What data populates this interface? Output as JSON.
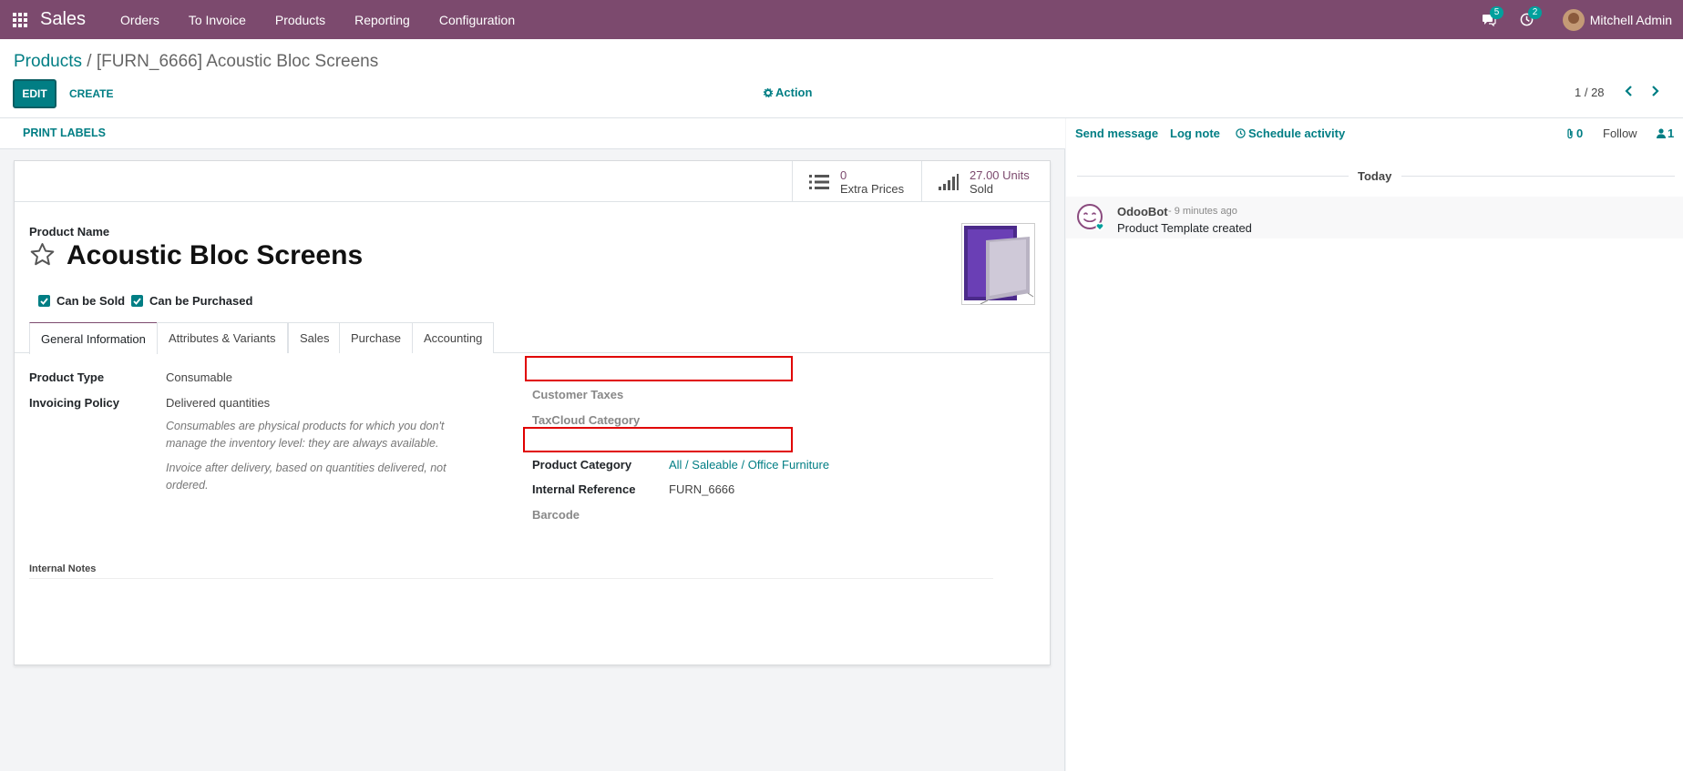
{
  "navbar": {
    "brand": "Sales",
    "menu": [
      "Orders",
      "To Invoice",
      "Products",
      "Reporting",
      "Configuration"
    ],
    "messages_badge": "5",
    "activities_badge": "2",
    "user_name": "Mitchell Admin",
    "color": "#7c4a6e"
  },
  "breadcrumb": {
    "parent": "Products",
    "separator": "/",
    "current": "[FURN_6666] Acoustic Bloc Screens"
  },
  "toolbar": {
    "edit_label": "EDIT",
    "create_label": "CREATE",
    "action_label": "Action",
    "pager": "1 / 28"
  },
  "statusbar": {
    "print_labels": "PRINT LABELS"
  },
  "smart_buttons": {
    "extra_prices_value": "0",
    "extra_prices_label": "Extra Prices",
    "sold_value": "27.00 Units",
    "sold_label": "Sold"
  },
  "product": {
    "name_label": "Product Name",
    "name": "Acoustic Bloc Screens",
    "can_be_sold": "Can be Sold",
    "can_be_purchased": "Can be Purchased"
  },
  "tabs": [
    "General Information",
    "Attributes & Variants",
    "Sales",
    "Purchase",
    "Accounting"
  ],
  "general": {
    "product_type_label": "Product Type",
    "product_type": "Consumable",
    "invoicing_policy_label": "Invoicing Policy",
    "invoicing_policy": "Delivered quantities",
    "help_consumable_1": "Consumables are physical products for which you don't",
    "help_consumable_2": "manage the inventory level: they are always available.",
    "help_invoice_1": "Invoice after delivery, based on quantities delivered, not",
    "help_invoice_2": "ordered.",
    "customer_taxes_label": "Customer Taxes",
    "taxcloud_label": "TaxCloud Category",
    "product_category_label": "Product Category",
    "product_category": "All / Saleable / Office Furniture",
    "internal_ref_label": "Internal Reference",
    "internal_ref": "FURN_6666",
    "barcode_label": "Barcode",
    "internal_notes_label": "Internal Notes"
  },
  "chatter": {
    "send_message": "Send message",
    "log_note": "Log note",
    "schedule_activity": "Schedule activity",
    "attachments": "0",
    "follow": "Follow",
    "followers": "1",
    "today": "Today",
    "message": {
      "author": "OdooBot",
      "date": "- 9 minutes ago",
      "body": "Product Template created"
    }
  }
}
